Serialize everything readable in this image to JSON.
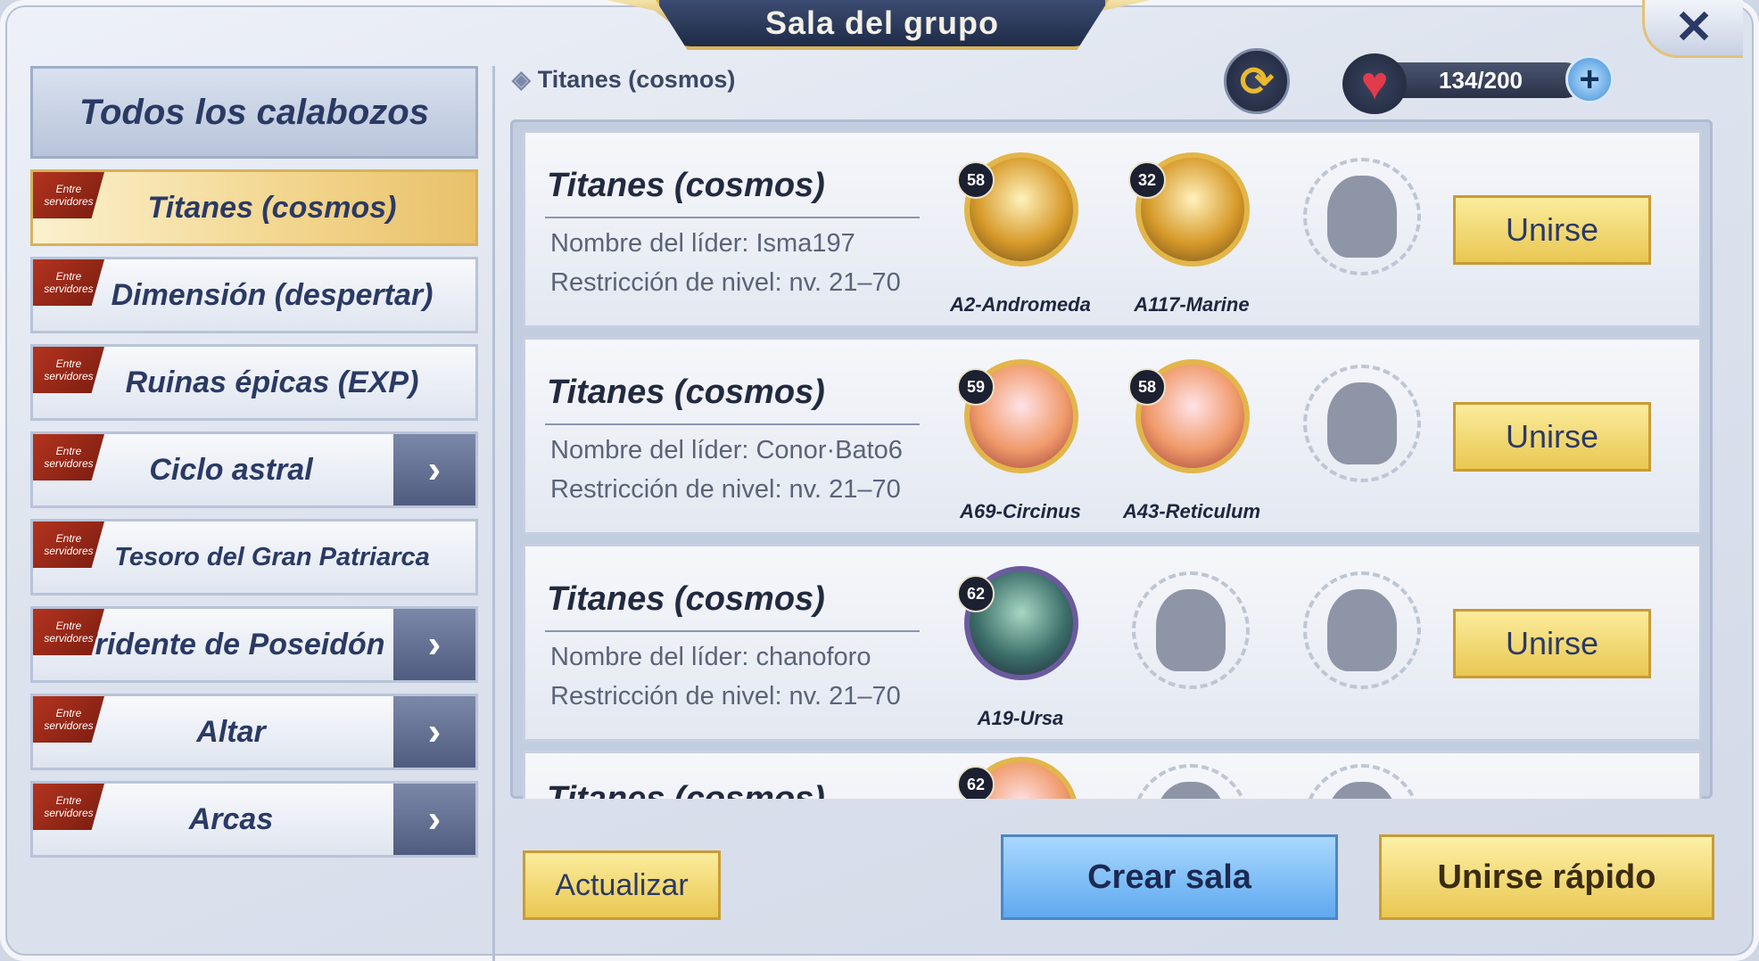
{
  "window": {
    "title": "Sala del grupo",
    "close_label": "✕"
  },
  "sidebar": {
    "all_label": "Todos los calabozos",
    "tag_line1": "Entre",
    "tag_line2": "servidores",
    "items": [
      {
        "label": "Titanes (cosmos)",
        "active": true,
        "has_arrow": false
      },
      {
        "label": "Dimensión (despertar)",
        "active": false,
        "has_arrow": false
      },
      {
        "label": "Ruinas épicas (EXP)",
        "active": false,
        "has_arrow": false
      },
      {
        "label": "Ciclo astral",
        "active": false,
        "has_arrow": true
      },
      {
        "label": "Tesoro del Gran Patriarca",
        "active": false,
        "has_arrow": false
      },
      {
        "label": "Tridente de Poseidón",
        "active": false,
        "has_arrow": true
      },
      {
        "label": "Altar",
        "active": false,
        "has_arrow": true
      },
      {
        "label": "Arcas",
        "active": false,
        "has_arrow": true
      }
    ]
  },
  "header": {
    "breadcrumb_icon": "◈",
    "breadcrumb": "Titanes (cosmos)",
    "refresh_icon": "refresh-icon",
    "energy_icon": "heart-icon",
    "energy": "134/200",
    "add_icon": "plus-icon"
  },
  "rooms": [
    {
      "title": "Titanes (cosmos)",
      "leader": "Nombre del líder: Isma197",
      "level": "Restricción de nivel: nv. 21–70",
      "members": [
        {
          "level": "58",
          "name": "A2-Andromeda"
        },
        {
          "level": "32",
          "name": "A117-Marine"
        }
      ],
      "join_label": "Unirse"
    },
    {
      "title": "Titanes (cosmos)",
      "leader": "Nombre del líder: Conor·Bato6",
      "level": "Restricción de nivel: nv. 21–70",
      "members": [
        {
          "level": "59",
          "name": "A69-Circinus"
        },
        {
          "level": "58",
          "name": "A43-Reticulum"
        }
      ],
      "join_label": "Unirse"
    },
    {
      "title": "Titanes (cosmos)",
      "leader": "Nombre del líder: chanoforo",
      "level": "Restricción de nivel: nv. 21–70",
      "members": [
        {
          "level": "62",
          "name": "A19-Ursa"
        }
      ],
      "join_label": "Unirse"
    },
    {
      "title": "Titanes (cosmos)",
      "members": [
        {
          "level": "62"
        }
      ]
    }
  ],
  "footer": {
    "refresh_label": "Actualizar",
    "create_label": "Crear sala",
    "quick_join_label": "Unirse rápido"
  },
  "colors": {
    "accent_gold": "#e9c752",
    "accent_blue": "#5fa9ef",
    "text_navy": "#2b3a64",
    "tag_red": "#b3341f"
  }
}
